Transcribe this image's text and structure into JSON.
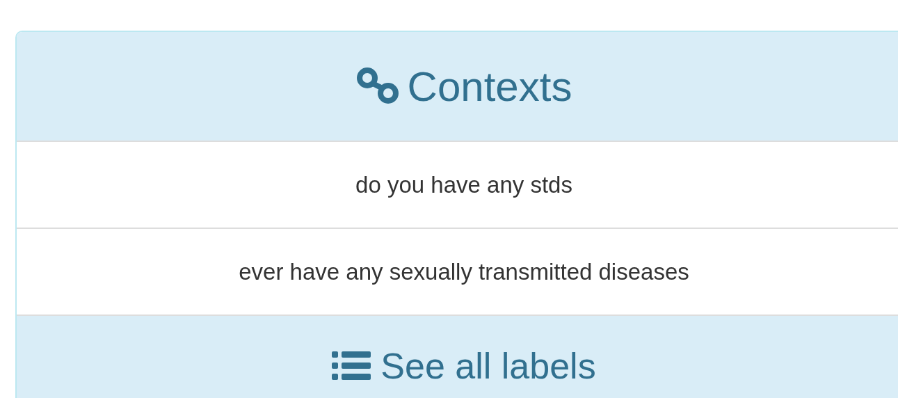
{
  "panel": {
    "title": "Contexts",
    "rows": [
      "do you have any stds",
      "ever have any sexually transmitted diseases"
    ],
    "footer": "See all labels"
  }
}
